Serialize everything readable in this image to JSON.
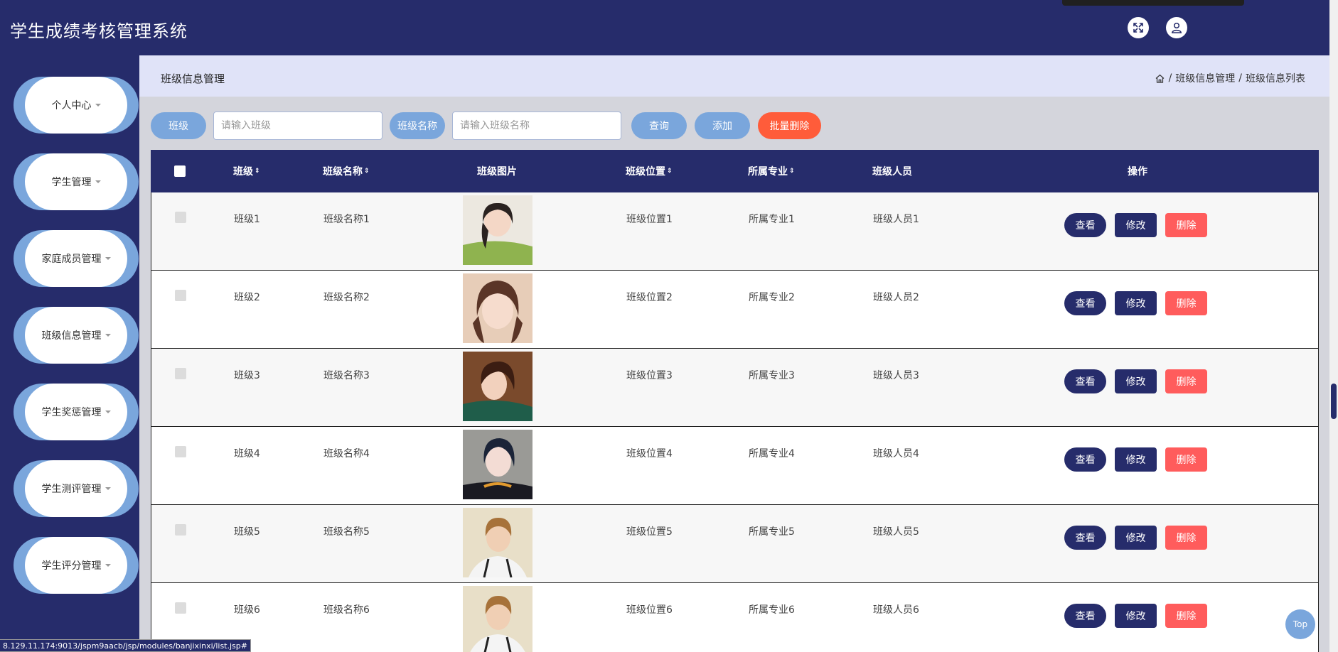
{
  "app": {
    "title": "学生成绩考核管理系统"
  },
  "header": {
    "fullscreen_icon": "expand-icon",
    "user_icon": "user-icon"
  },
  "sidebar": {
    "items": [
      {
        "label": "个人中心"
      },
      {
        "label": "学生管理"
      },
      {
        "label": "家庭成员管理"
      },
      {
        "label": "班级信息管理"
      },
      {
        "label": "学生奖惩管理"
      },
      {
        "label": "学生测评管理"
      },
      {
        "label": "学生评分管理"
      }
    ]
  },
  "page": {
    "title": "班级信息管理",
    "breadcrumb": [
      "班级信息管理",
      "班级信息列表"
    ],
    "breadcrumb_sep": "/"
  },
  "search": {
    "class_label": "班级",
    "class_placeholder": "请输入班级",
    "name_label": "班级名称",
    "name_placeholder": "请输入班级名称",
    "query_button": "查询",
    "add_button": "添加",
    "batch_delete_button": "批量删除"
  },
  "table": {
    "headers": {
      "class": "班级",
      "name": "班级名称",
      "image": "班级图片",
      "location": "班级位置",
      "major": "所属专业",
      "members": "班级人员",
      "actions": "操作"
    },
    "sort_glyph": "⇕",
    "rows": [
      {
        "class": "班级1",
        "name": "班级名称1",
        "location": "班级位置1",
        "major": "所属专业1",
        "members": "班级人员1"
      },
      {
        "class": "班级2",
        "name": "班级名称2",
        "location": "班级位置2",
        "major": "所属专业2",
        "members": "班级人员2"
      },
      {
        "class": "班级3",
        "name": "班级名称3",
        "location": "班级位置3",
        "major": "所属专业3",
        "members": "班级人员3"
      },
      {
        "class": "班级4",
        "name": "班级名称4",
        "location": "班级位置4",
        "major": "所属专业4",
        "members": "班级人员4"
      },
      {
        "class": "班级5",
        "name": "班级名称5",
        "location": "班级位置5",
        "major": "所属专业5",
        "members": "班级人员5"
      },
      {
        "class": "班级6",
        "name": "班级名称6",
        "location": "班级位置6",
        "major": "所属专业6",
        "members": "班级人员6"
      }
    ],
    "actions": {
      "view": "查看",
      "edit": "修改",
      "delete": "删除"
    }
  },
  "top_button": "Top",
  "status_url": "8.129.11.174:9013/jspm9aacb/jsp/modules/banjixinxi/list.jsp#",
  "colors": {
    "primary": "#262c6b",
    "accent": "#7aa6dc",
    "danger": "#ff5c5c",
    "header_bg": "#e0e3f8"
  }
}
